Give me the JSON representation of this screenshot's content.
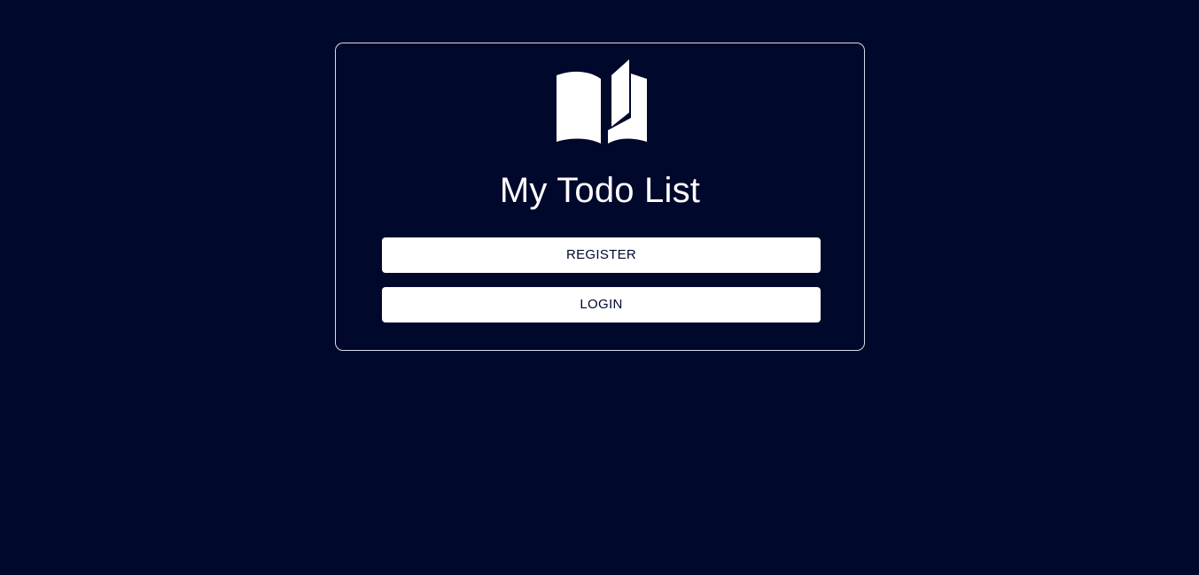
{
  "colors": {
    "background": "#00082c",
    "card_border": "#d7dae6",
    "button_bg": "#ffffff",
    "button_text": "#00082c",
    "title_text": "#ffffff"
  },
  "card": {
    "logo_icon": "open-book-icon",
    "title": "My Todo List",
    "register_label": "REGISTER",
    "login_label": "LOGIN"
  }
}
